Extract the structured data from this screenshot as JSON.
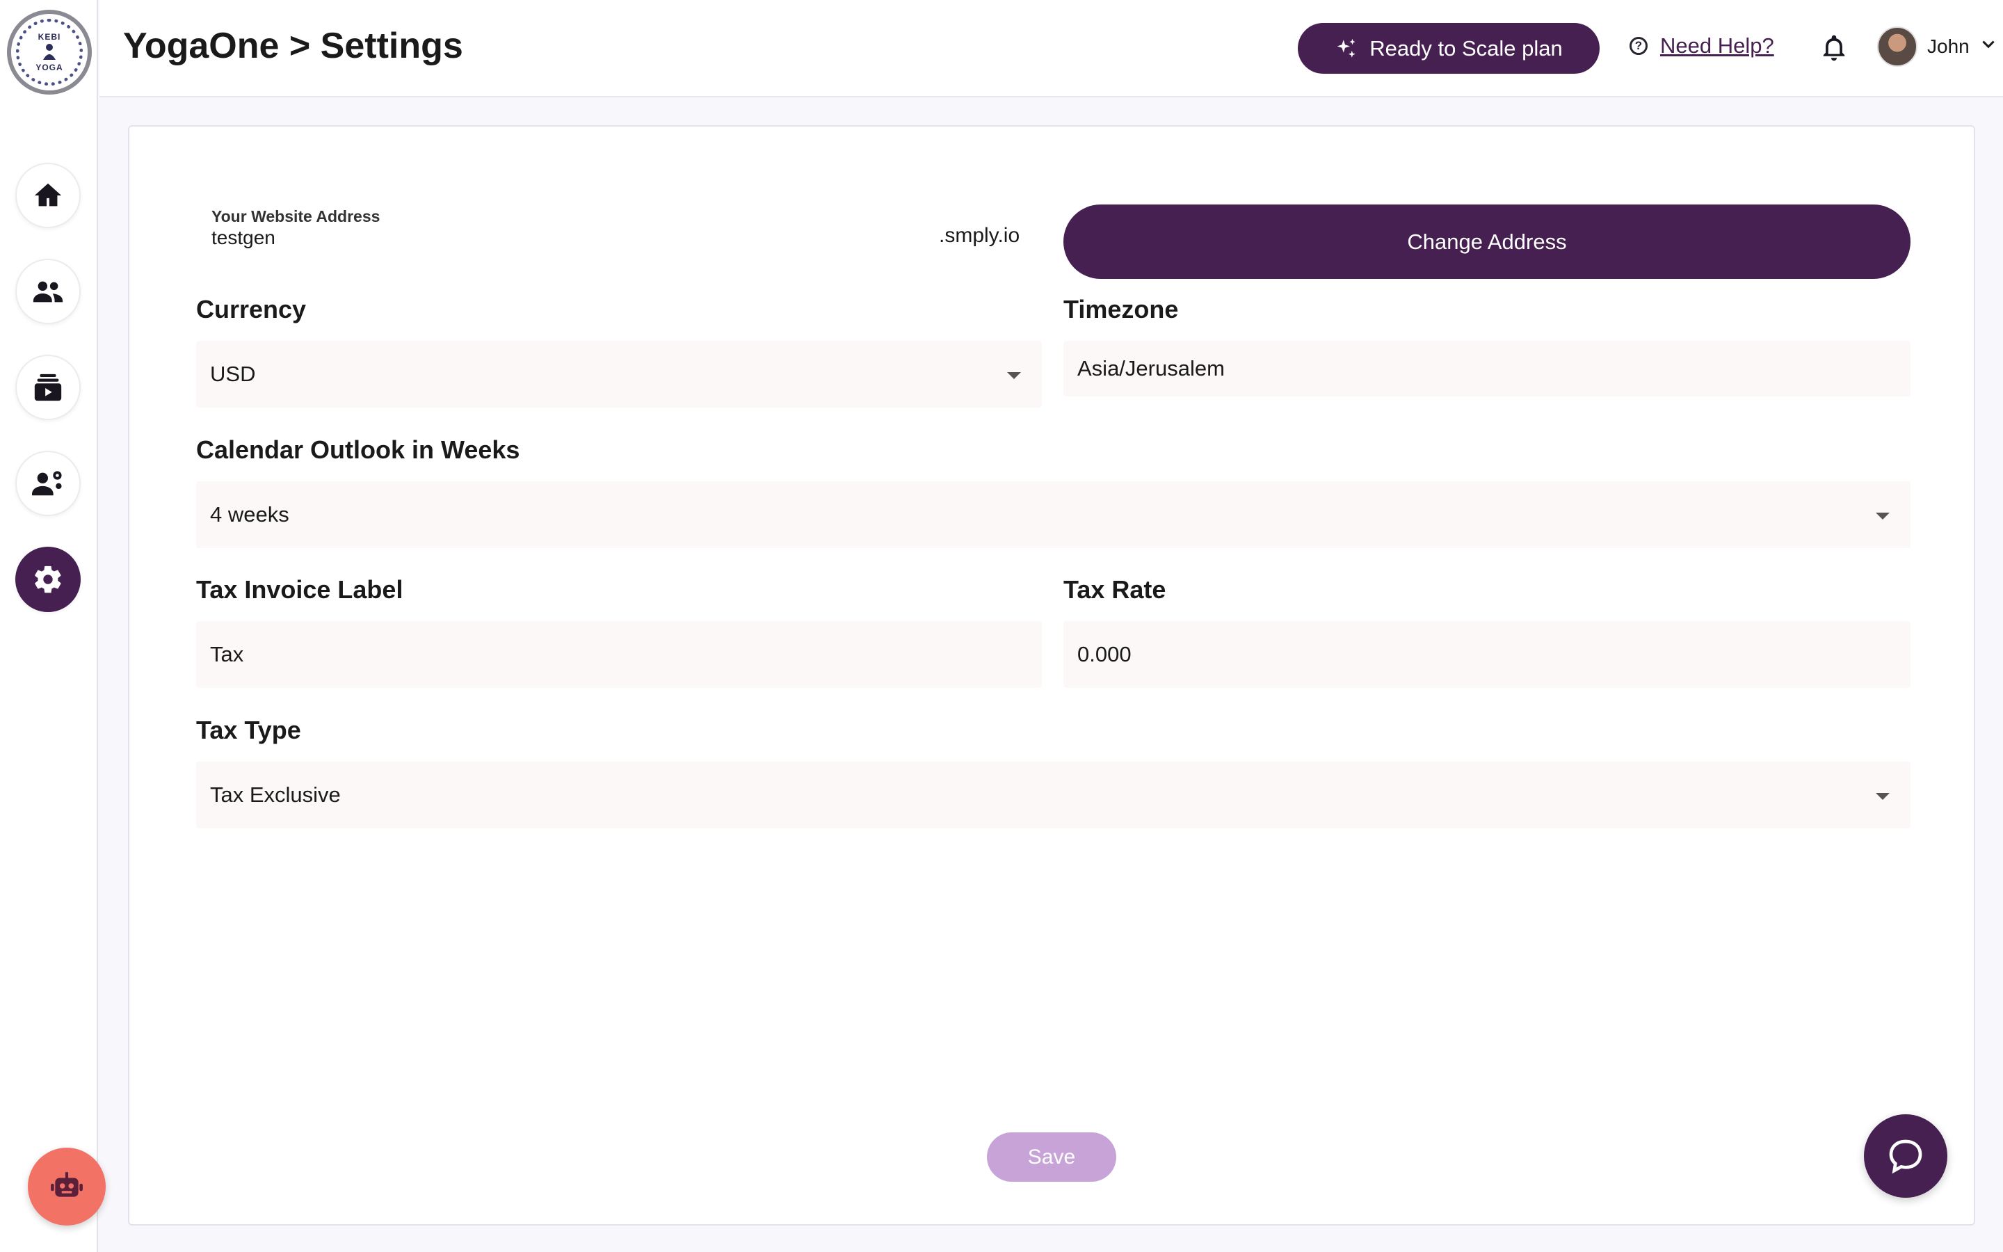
{
  "sidebar": {
    "logo_text_top": "KEBI",
    "logo_text_bottom": "YOGA",
    "items": [
      {
        "icon": "home-icon"
      },
      {
        "icon": "people-icon"
      },
      {
        "icon": "classes-icon"
      },
      {
        "icon": "staff-settings-icon"
      },
      {
        "icon": "gear-icon",
        "active": true
      }
    ],
    "assistant_icon": "robot-icon"
  },
  "header": {
    "title": "YogaOne > Settings",
    "plan_button": "Ready to Scale plan",
    "help_icon": "?",
    "help_link": "Need Help?",
    "user_name": "John"
  },
  "form": {
    "website_label": "Your Website Address",
    "website_value": "testgen",
    "website_suffix": ".smply.io",
    "change_address_button": "Change Address",
    "currency_label": "Currency",
    "currency_value": "USD",
    "timezone_label": "Timezone",
    "timezone_value": "Asia/Jerusalem",
    "calendar_label": "Calendar Outlook in Weeks",
    "calendar_value": "4 weeks",
    "tax_label_label": "Tax Invoice Label",
    "tax_label_value": "Tax",
    "tax_rate_label": "Tax Rate",
    "tax_rate_value": "0.000",
    "tax_type_label": "Tax Type",
    "tax_type_value": "Tax Exclusive",
    "save_button": "Save"
  },
  "colors": {
    "brand": "#452050",
    "save_disabled": "#c8a3d8",
    "assistant": "#f27366",
    "field_bg": "#fcf8f8"
  }
}
